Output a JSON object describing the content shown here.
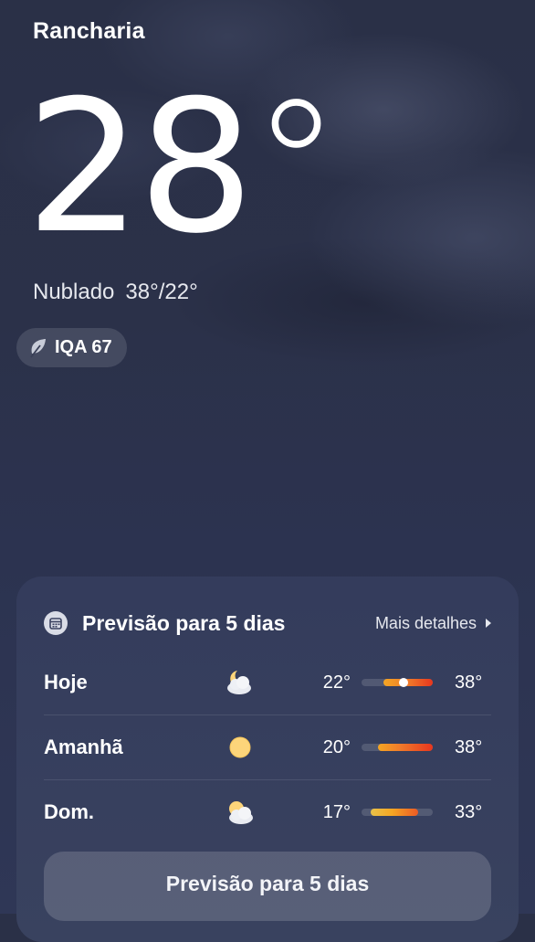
{
  "location": {
    "city": "Rancharia"
  },
  "current": {
    "temperature": "28",
    "degree_symbol": "°",
    "condition": "Nublado",
    "high_low": "38°/22°"
  },
  "aqi": {
    "label": "IQA 67"
  },
  "forecast": {
    "title": "Previsão para 5 dias",
    "more_details": "Mais detalhes",
    "days": [
      {
        "day": "Hoje",
        "icon": "partly-cloudy-night-icon",
        "min": "22°",
        "max": "38°",
        "current_position": 0.6
      },
      {
        "day": "Amanhã",
        "icon": "sun-icon",
        "min": "20°",
        "max": "38°"
      },
      {
        "day": "Dom.",
        "icon": "partly-cloudy-day-icon",
        "min": "17°",
        "max": "33°"
      }
    ],
    "button_label": "Previsão para 5 dias"
  },
  "colors": {
    "background": "#2b3149",
    "card": "#363e5d",
    "bar_warm": "#f5a623",
    "bar_hot": "#e8361e",
    "sun": "#fdd57a"
  }
}
